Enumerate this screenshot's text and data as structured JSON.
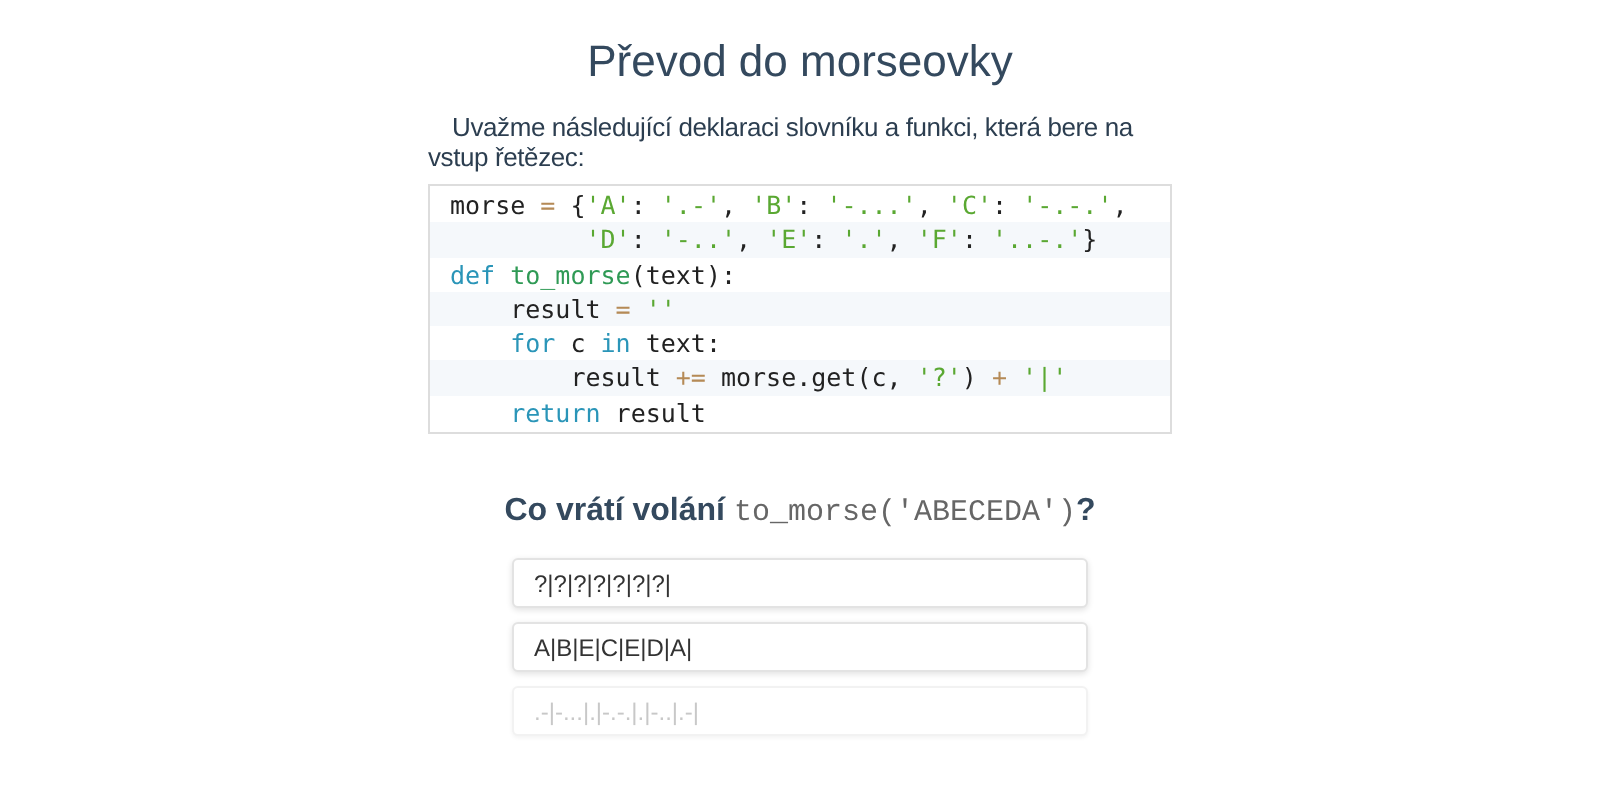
{
  "title": "Převod do morseovky",
  "intro": "Uvažme následující deklaraci slovníku a funkci, která bere na vstup řetězec:",
  "code": [
    [
      {
        "t": "morse ",
        "kind": "n"
      },
      {
        "t": "=",
        "kind": "o"
      },
      {
        "t": " {",
        "kind": "n"
      },
      {
        "t": "'A'",
        "kind": "s"
      },
      {
        "t": ": ",
        "kind": "n"
      },
      {
        "t": "'.-'",
        "kind": "s"
      },
      {
        "t": ", ",
        "kind": "n"
      },
      {
        "t": "'B'",
        "kind": "s"
      },
      {
        "t": ": ",
        "kind": "n"
      },
      {
        "t": "'-...'",
        "kind": "s"
      },
      {
        "t": ", ",
        "kind": "n"
      },
      {
        "t": "'C'",
        "kind": "s"
      },
      {
        "t": ": ",
        "kind": "n"
      },
      {
        "t": "'-.-.'",
        "kind": "s"
      },
      {
        "t": ",",
        "kind": "n"
      }
    ],
    [
      {
        "t": "         'D'",
        "kind": "s"
      },
      {
        "t": ": ",
        "kind": "n"
      },
      {
        "t": "'-..'",
        "kind": "s"
      },
      {
        "t": ", ",
        "kind": "n"
      },
      {
        "t": "'E'",
        "kind": "s"
      },
      {
        "t": ": ",
        "kind": "n"
      },
      {
        "t": "'.'",
        "kind": "s"
      },
      {
        "t": ", ",
        "kind": "n"
      },
      {
        "t": "'F'",
        "kind": "s"
      },
      {
        "t": ": ",
        "kind": "n"
      },
      {
        "t": "'..-.'",
        "kind": "s"
      },
      {
        "t": "}",
        "kind": "n"
      }
    ],
    [
      {
        "t": "def ",
        "kind": "k"
      },
      {
        "t": "to_morse",
        "kind": "f"
      },
      {
        "t": "(text):",
        "kind": "n"
      }
    ],
    [
      {
        "t": "    result ",
        "kind": "n"
      },
      {
        "t": "= ",
        "kind": "o"
      },
      {
        "t": "''",
        "kind": "s"
      }
    ],
    [
      {
        "t": "    for",
        "kind": "k"
      },
      {
        "t": " c ",
        "kind": "n"
      },
      {
        "t": "in",
        "kind": "k"
      },
      {
        "t": " text:",
        "kind": "n"
      }
    ],
    [
      {
        "t": "        result ",
        "kind": "n"
      },
      {
        "t": "+=",
        "kind": "o"
      },
      {
        "t": " morse.get(c, ",
        "kind": "n"
      },
      {
        "t": "'?'",
        "kind": "s"
      },
      {
        "t": ") ",
        "kind": "n"
      },
      {
        "t": "+ ",
        "kind": "o"
      },
      {
        "t": "'|'",
        "kind": "s"
      }
    ],
    [
      {
        "t": "    return",
        "kind": "k"
      },
      {
        "t": " result",
        "kind": "n"
      }
    ]
  ],
  "question": {
    "text": "Co vrátí volání",
    "code": "to_morse('ABECEDA')",
    "mark": "?"
  },
  "options": [
    {
      "label": "?|?|?|?|?|?|?|",
      "faded": false
    },
    {
      "label": "A|B|E|C|E|D|A|",
      "faded": false
    },
    {
      "label": ".-|-...|.|-.-.|.|-..|.-|",
      "faded": true
    }
  ]
}
